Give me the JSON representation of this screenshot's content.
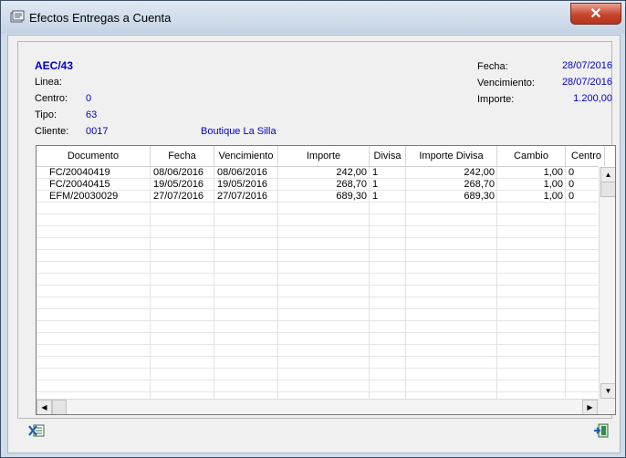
{
  "window": {
    "title": "Efectos Entregas a Cuenta"
  },
  "header": {
    "code": "AEC/43",
    "linea_label": "Linea:",
    "linea_value": "",
    "centro_label": "Centro:",
    "centro_value": "0",
    "tipo_label": "Tipo:",
    "tipo_value": "63",
    "cliente_label": "Cliente:",
    "cliente_code": "0017",
    "cliente_name": "Boutique La Silla",
    "fecha_label": "Fecha:",
    "fecha_value": "28/07/2016",
    "vencimiento_label": "Vencimiento:",
    "vencimiento_value": "28/07/2016",
    "importe_label": "Importe:",
    "importe_value": "1.200,00"
  },
  "grid": {
    "columns": [
      "Documento",
      "Fecha",
      "Vencimiento",
      "Importe",
      "Divisa",
      "Importe Divisa",
      "Cambio",
      "Centro"
    ],
    "rows": [
      [
        "FC/20040419",
        "08/06/2016",
        "08/06/2016",
        "242,00",
        "1",
        "242,00",
        "1,00",
        "0"
      ],
      [
        "FC/20040415",
        "19/05/2016",
        "19/05/2016",
        "268,70",
        "1",
        "268,70",
        "1,00",
        "0"
      ],
      [
        "EFM/20030029",
        "27/07/2016",
        "27/07/2016",
        "689,30",
        "1",
        "689,30",
        "1,00",
        "0"
      ]
    ]
  },
  "footer": {
    "left_icon": "excel-export-icon",
    "right_icon": "exit-icon"
  }
}
